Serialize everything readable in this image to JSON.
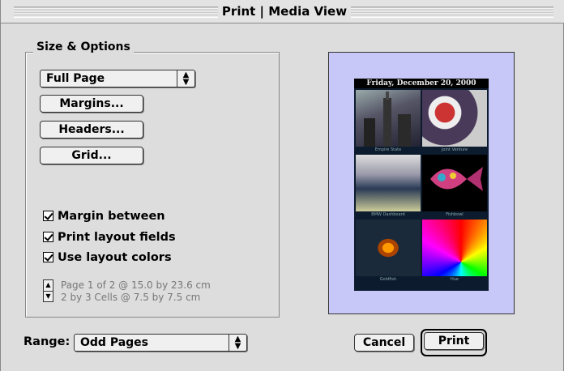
{
  "window": {
    "title": "Print | Media View"
  },
  "options": {
    "group_label": "Size & Options",
    "size_popup": "Full Page",
    "buttons": {
      "margins": "Margins...",
      "headers": "Headers...",
      "grid": "Grid..."
    },
    "checkboxes": [
      {
        "label": "Margin between",
        "checked": true
      },
      {
        "label": "Print layout fields",
        "checked": true
      },
      {
        "label": "Use layout colors",
        "checked": true
      }
    ],
    "page_info": {
      "line1": "Page 1 of 2 @ 15.0 by 23.6 cm",
      "line2": "2 by 3 Cells @ 7.5 by 7.5 cm"
    }
  },
  "preview": {
    "header": "Friday, December 20, 2000",
    "background_color": "#c8c8f8",
    "cells": [
      {
        "caption": "Empire State"
      },
      {
        "caption": "Joint Venture"
      },
      {
        "caption": "BMW Dashboard"
      },
      {
        "caption": "Fishbowl"
      },
      {
        "caption": "Goldfish"
      },
      {
        "caption": "Hue"
      }
    ]
  },
  "footer": {
    "range_label": "Range:",
    "range_value": "Odd Pages",
    "cancel": "Cancel",
    "print": "Print"
  }
}
